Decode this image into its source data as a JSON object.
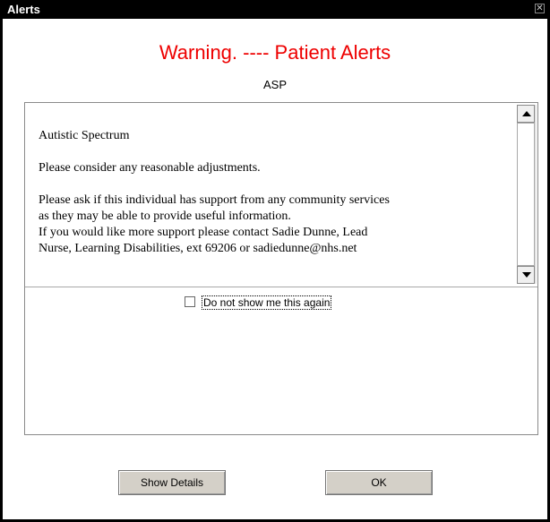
{
  "window": {
    "title": "Alerts",
    "close_glyph": "✕"
  },
  "alert": {
    "heading": "Warning. ----  Patient Alerts",
    "code": "ASP",
    "text": "Autistic Spectrum\n\nPlease consider any reasonable adjustments.\n\nPlease ask if this individual has support from any community services\nas they may be able to provide useful information.\nIf you would like more support please contact Sadie Dunne, Lead\nNurse, Learning Disabilities, ext 69206 or sadiedunne@nhs.net"
  },
  "options": {
    "dont_show_again_label": "Do not show me this again",
    "dont_show_again_checked": false
  },
  "buttons": {
    "show_details": "Show Details",
    "ok": "OK"
  },
  "colors": {
    "heading": "#ee0000",
    "titlebar": "#000000"
  },
  "icons": {
    "close": "close-icon",
    "scroll_up": "chevron-up-icon",
    "scroll_down": "chevron-down-icon"
  }
}
